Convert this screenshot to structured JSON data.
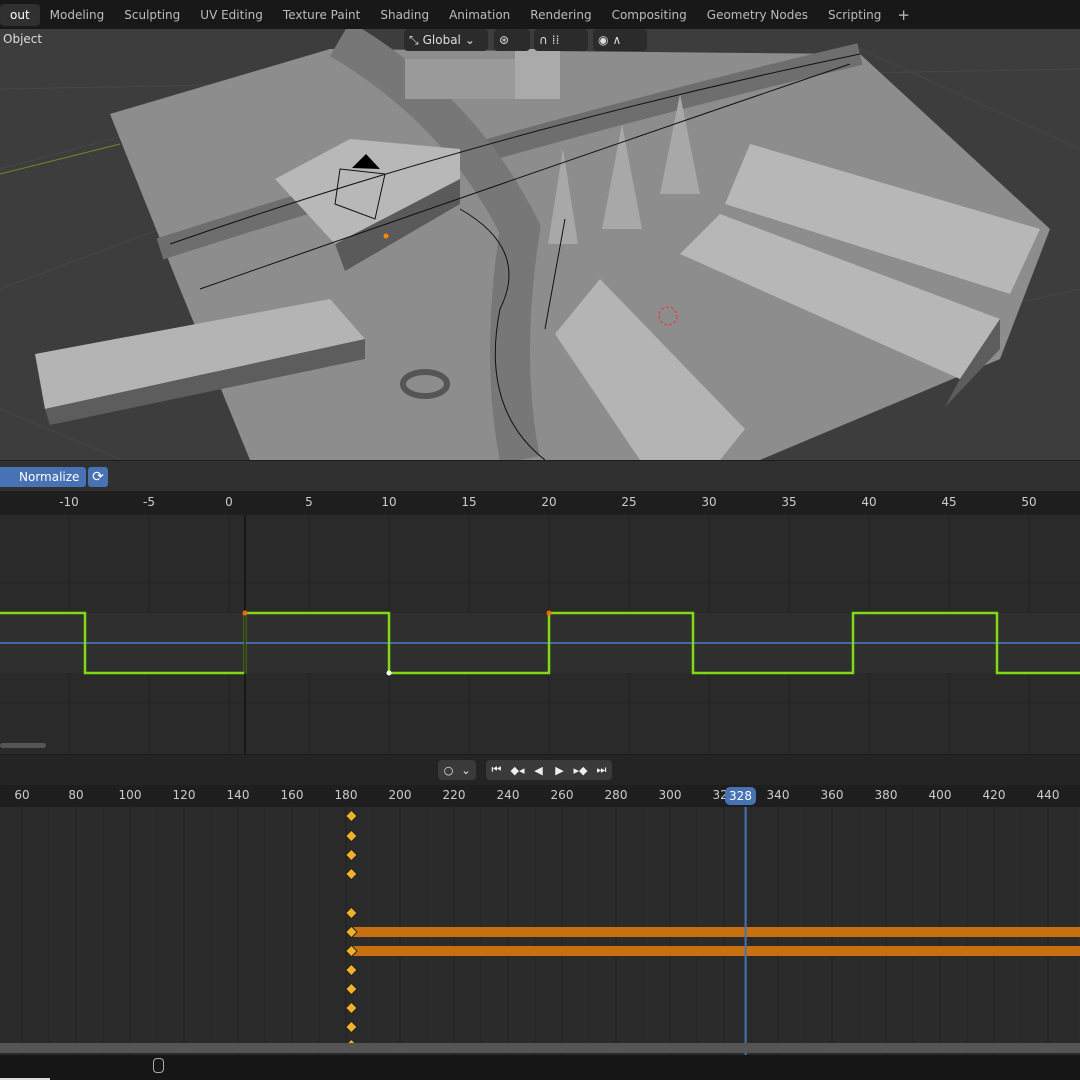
{
  "workspace_tabs": [
    "out",
    "Modeling",
    "Sculpting",
    "UV Editing",
    "Texture Paint",
    "Shading",
    "Animation",
    "Rendering",
    "Compositing",
    "Geometry Nodes",
    "Scripting"
  ],
  "active_tab": "out",
  "add_tab_icon": "plus-icon",
  "viewport": {
    "mode": "Object",
    "transform_orientation": "Global",
    "icons": [
      "transform-orientation-icon",
      "pivot-icon",
      "snap-icon",
      "snap-increment-icon",
      "proportional-edit-icon",
      "falloff-icon"
    ]
  },
  "graph_editor": {
    "normalize_label": "Normalize",
    "ruler_ticks": [
      "-10",
      "-5",
      "0",
      "5",
      "10",
      "15",
      "20",
      "25",
      "30",
      "35",
      "40",
      "45",
      "50"
    ],
    "curve_colors": {
      "square_wave": "#7fdb10",
      "flat": "#4a7bd0"
    },
    "square_wave_transitions": [
      -9,
      1,
      10,
      20,
      29,
      39,
      48
    ],
    "current_frame": 1
  },
  "dope_sheet": {
    "playback_icons": [
      "record-icon",
      "jump-start-icon",
      "prev-keyframe-icon",
      "play-reverse-icon",
      "play-icon",
      "next-keyframe-icon",
      "jump-end-icon"
    ],
    "ruler_ticks": [
      "60",
      "80",
      "100",
      "120",
      "140",
      "160",
      "180",
      "200",
      "220",
      "240",
      "260",
      "280",
      "300",
      "320",
      "340",
      "360",
      "380",
      "400",
      "420",
      "440"
    ],
    "current_frame": "328",
    "keyframe_frame": 182,
    "keyframe_color": "#f0b22c",
    "hold_bar_color": "#c8700f"
  },
  "status_bar": {
    "icons": [
      "mouse-icon"
    ]
  }
}
